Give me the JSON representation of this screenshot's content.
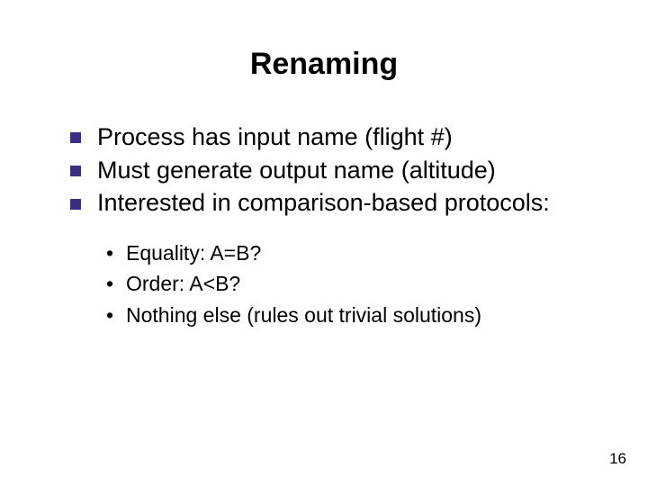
{
  "title": "Renaming",
  "bullets": {
    "b0": "Process has input name (flight #)",
    "b1": "Must generate output name (altitude)",
    "b2": "Interested in comparison-based protocols:"
  },
  "sub": {
    "s0": "Equality: A=B?",
    "s1": "Order: A<B?",
    "s2": "Nothing else (rules out trivial solutions)"
  },
  "page_number": "16"
}
